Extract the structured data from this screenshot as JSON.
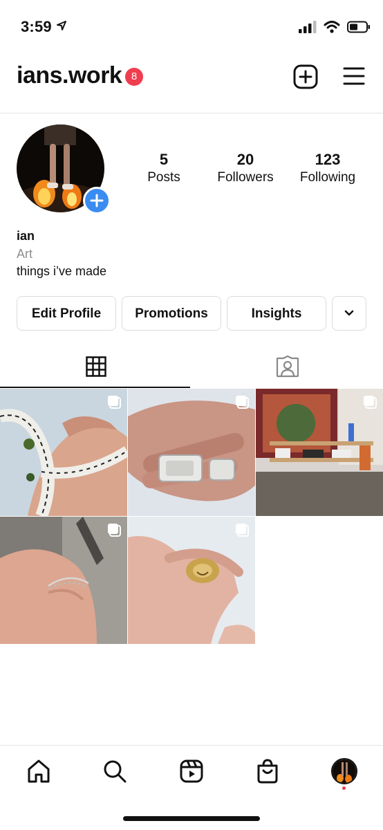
{
  "status_bar": {
    "time": "3:59"
  },
  "header": {
    "username": "ians.work",
    "notification_count": "8"
  },
  "profile": {
    "stats": [
      {
        "num": "5",
        "label": "Posts"
      },
      {
        "num": "20",
        "label": "Followers"
      },
      {
        "num": "123",
        "label": "Following"
      }
    ],
    "name": "ian",
    "category": "Art",
    "bio": "things i’ve made"
  },
  "actions": {
    "edit_profile": "Edit Profile",
    "promotions": "Promotions",
    "insights": "Insights"
  },
  "icons": {
    "location": "location-arrow-icon",
    "signal": "cell-signal-icon",
    "wifi": "wifi-icon",
    "battery": "battery-icon",
    "new_post": "plus-square-icon",
    "menu": "hamburger-menu-icon",
    "grid": "grid-icon",
    "tagged": "tagged-person-icon",
    "multi": "multiple-photos-icon",
    "home": "home-icon",
    "search": "search-icon",
    "reels": "reels-icon",
    "shop": "shopping-bag-icon",
    "profile": "profile-avatar"
  },
  "colors": {
    "badge": "#ef3e4f",
    "add_story": "#3a8cf0",
    "border": "#dbdbdb",
    "muted_text": "#8e8e8e"
  },
  "posts": [
    {
      "subject": "braided fabric bracelet on hand",
      "multiple": true
    },
    {
      "subject": "silver rings on fingers",
      "multiple": true
    },
    {
      "subject": "room with tapestry and shelf",
      "multiple": true
    },
    {
      "subject": "chain bracelet on wrist",
      "multiple": true
    },
    {
      "subject": "gold ring on finger",
      "multiple": true
    }
  ]
}
